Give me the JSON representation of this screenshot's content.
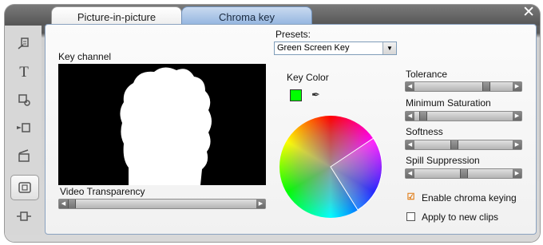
{
  "tabs": [
    {
      "label": "Picture-in-picture",
      "active": false
    },
    {
      "label": "Chroma key",
      "active": true
    }
  ],
  "sidebar": {
    "items": [
      {
        "icon": "clip-properties-icon"
      },
      {
        "icon": "title-text-icon"
      },
      {
        "icon": "audio-effects-icon"
      },
      {
        "icon": "video-effects-icon"
      },
      {
        "icon": "clapper-board-icon"
      },
      {
        "icon": "picture-in-picture-icon",
        "active": true
      },
      {
        "icon": "plugin-connector-icon"
      }
    ]
  },
  "presets": {
    "label": "Presets:",
    "selected": "Green Screen Key"
  },
  "key_channel": {
    "label": "Key channel"
  },
  "video_transparency": {
    "label": "Video Transparency",
    "value": 0.0
  },
  "key_color": {
    "label": "Key Color",
    "color": "#00ff00"
  },
  "sliders": [
    {
      "label": "Tolerance",
      "value": 0.75
    },
    {
      "label": "Minimum Saturation",
      "value": 0.05
    },
    {
      "label": "Softness",
      "value": 0.4
    },
    {
      "label": "Spill Suppression",
      "value": 0.5
    }
  ],
  "options": {
    "enable_chroma": {
      "label": "Enable chroma keying",
      "checked": true
    },
    "apply_new": {
      "label": "Apply to new clips",
      "checked": false
    }
  },
  "colors": {
    "accent_blue": "#8fb2de",
    "check_orange": "#e07a12"
  }
}
